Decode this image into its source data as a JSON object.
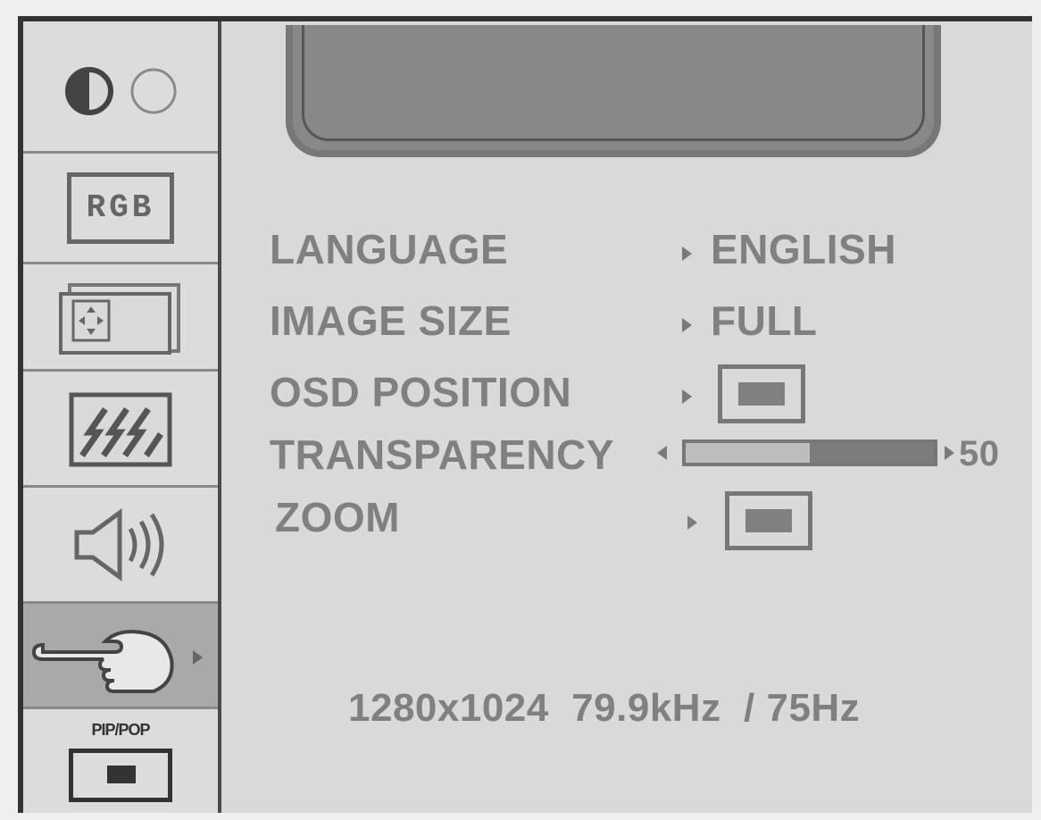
{
  "sidebar": {
    "items": [
      {
        "name": "picture",
        "icon": "brightness-contrast-icon"
      },
      {
        "name": "color",
        "icon": "rgb-icon",
        "label": "RGB"
      },
      {
        "name": "geometry",
        "icon": "position-icon"
      },
      {
        "name": "tracking",
        "icon": "tracking-icon"
      },
      {
        "name": "audio",
        "icon": "speaker-icon"
      },
      {
        "name": "setup",
        "icon": "pointing-hand-icon",
        "selected": true
      },
      {
        "name": "pip",
        "icon": "pip-icon",
        "label": "PIP/POP"
      }
    ]
  },
  "menu": {
    "language": {
      "label": "LANGUAGE",
      "value": "ENGLISH"
    },
    "image_size": {
      "label": "IMAGE SIZE",
      "value": "FULL"
    },
    "osd_position": {
      "label": "OSD POSITION",
      "icon": "osd-position-center-icon"
    },
    "transparency": {
      "label": "TRANSPARENCY",
      "value": "50",
      "level": 0.5
    },
    "zoom": {
      "label": "ZOOM",
      "icon": "zoom-box-icon"
    }
  },
  "status": {
    "readout": "1280x1024  79.9kHz  / 75Hz"
  }
}
